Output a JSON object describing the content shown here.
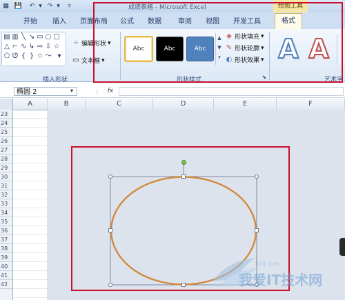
{
  "window": {
    "title": "成绩表格 - Microsoft Excel",
    "drawing_tools_label": "绘图工具"
  },
  "quick_access": [
    "save-icon",
    "undo-icon",
    "redo-icon",
    "customize-icon"
  ],
  "tabs": [
    "开始",
    "插入",
    "页面布局",
    "公式",
    "数据",
    "审阅",
    "视图",
    "开发工具",
    "格式"
  ],
  "active_tab": "格式",
  "ribbon": {
    "insert_shapes": {
      "label": "插入形状",
      "edit_shape": "编辑形状",
      "text_box": "文本框"
    },
    "shape_styles": {
      "label": "形状样式",
      "presets": [
        "Abc",
        "Abc",
        "Abc"
      ],
      "shape_fill": "形状填充",
      "shape_outline": "形状轮廓",
      "shape_effects": "形状效果"
    },
    "wordart_styles": {
      "label": "艺术字",
      "presets": [
        "A",
        "A"
      ]
    }
  },
  "formula_bar": {
    "name_box": "椭圆 2",
    "fx_label": "fx"
  },
  "columns": [
    "A",
    "B",
    "C",
    "D",
    "E",
    "F"
  ],
  "rows": [
    "23",
    "24",
    "25",
    "26",
    "27",
    "28",
    "29",
    "30",
    "31",
    "32",
    "33",
    "34",
    "35",
    "36",
    "37",
    "38",
    "39",
    "40",
    "41",
    "42"
  ],
  "watermark": {
    "text": "我爱IT技术网",
    "url": "52ij.com"
  },
  "colors": {
    "ellipse_stroke": "#d08a3e",
    "highlight_red": "#c8102e",
    "rotate_handle": "#7cc24a"
  }
}
